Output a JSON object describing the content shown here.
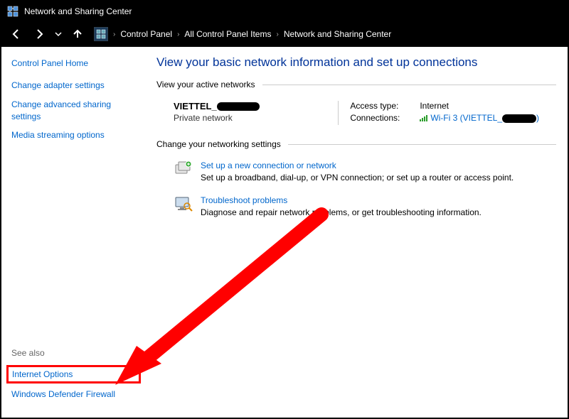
{
  "window_title": "Network and Sharing Center",
  "breadcrumb": {
    "items": [
      "Control Panel",
      "All Control Panel Items",
      "Network and Sharing Center"
    ]
  },
  "sidebar": {
    "home": "Control Panel Home",
    "links": [
      "Change adapter settings",
      "Change advanced sharing settings",
      "Media streaming options"
    ],
    "see_also_label": "See also",
    "see_also": [
      "Internet Options",
      "Windows Defender Firewall"
    ]
  },
  "main": {
    "title": "View your basic network information and set up connections",
    "active_networks_label": "View your active networks",
    "network": {
      "name_prefix": "VIETTEL_",
      "type": "Private network",
      "access_type_label": "Access type:",
      "access_type_value": "Internet",
      "connections_label": "Connections:",
      "connection_name_prefix": "Wi-Fi 3 (VIETTEL_",
      "connection_name_suffix": ")"
    },
    "change_settings_label": "Change your networking settings",
    "tasks": [
      {
        "title": "Set up a new connection or network",
        "desc": "Set up a broadband, dial-up, or VPN connection; or set up a router or access point."
      },
      {
        "title": "Troubleshoot problems",
        "desc": "Diagnose and repair network problems, or get troubleshooting information."
      }
    ]
  },
  "annotation": {
    "highlighted_item": "Internet Options",
    "arrow_color": "#ff0000"
  }
}
